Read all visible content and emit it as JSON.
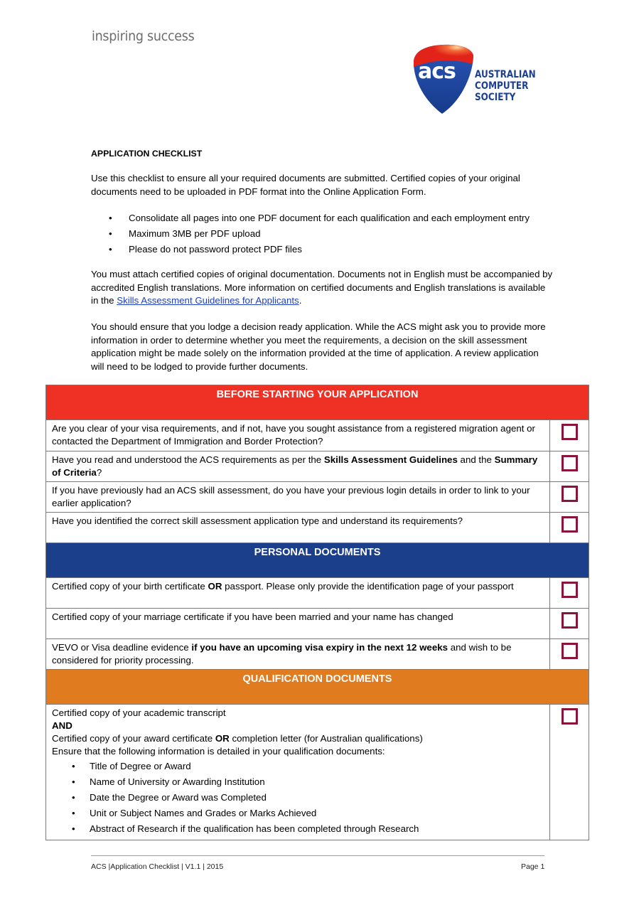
{
  "header": {
    "tagline": "inspiring success",
    "logo": {
      "mark": "acs",
      "name_lines": [
        "AUSTRALIAN",
        "COMPUTER",
        "SOCIETY"
      ],
      "colors": {
        "shield_blue": "#1c3f94",
        "shield_red": "#e2231a",
        "text_blue": "#1c3f94"
      }
    }
  },
  "document": {
    "title": "APPLICATION CHECKLIST",
    "intro": "Use this checklist to ensure all your required documents are submitted. Certified copies of your original documents need to be uploaded in PDF format into the Online Application Form.",
    "bullets": [
      "Consolidate all pages into one PDF document for each qualification and each employment entry",
      "Maximum 3MB per PDF upload",
      "Please do not password protect PDF files"
    ],
    "para2_before_link": "You must attach certified copies of original documentation. Documents not in English must be accompanied by accredited English translations. More information on certified documents and English translations is available in the ",
    "para2_link": "Skills Assessment Guidelines for Applicants",
    "para2_after_link": ".",
    "para3": "You should ensure that you lodge a decision ready application. While the ACS might ask you to provide more information in order to determine whether you meet the requirements, a decision on the skill assessment application might be made solely on the information provided at the time of application. A review application will need to be lodged to provide further documents."
  },
  "checklist": {
    "sections": [
      {
        "title": "BEFORE STARTING YOUR APPLICATION",
        "color": "#ee3124",
        "items": [
          {
            "parts": [
              {
                "t": "Are you clear of your visa requirements, and if not, have you sought assistance from a registered migration agent or contacted the Department of Immigration and Border Protection?"
              }
            ],
            "checked": false
          },
          {
            "parts": [
              {
                "t": "Have you read and understood the ACS requirements as per the "
              },
              {
                "t": "Skills Assessment Guidelines",
                "b": true
              },
              {
                "t": " and the "
              },
              {
                "t": "Summary of Criteria",
                "b": true
              },
              {
                "t": "?"
              }
            ],
            "checked": false
          },
          {
            "parts": [
              {
                "t": "If you have previously had an ACS skill assessment, do you have your previous login details in order to link to your earlier application?"
              }
            ],
            "checked": false
          },
          {
            "parts": [
              {
                "t": "Have you identified the correct skill assessment application type and understand its requirements?"
              }
            ],
            "checked": false
          }
        ]
      },
      {
        "title": "PERSONAL DOCUMENTS",
        "color": "#1b3f8b",
        "items": [
          {
            "parts": [
              {
                "t": "Certified copy of your birth certificate "
              },
              {
                "t": "OR",
                "b": true
              },
              {
                "t": " passport. Please only provide the identification page of your passport"
              }
            ],
            "checked": false
          },
          {
            "parts": [
              {
                "t": "Certified copy of your marriage certificate if you have been married and your name has changed"
              }
            ],
            "checked": false
          },
          {
            "parts": [
              {
                "t": "VEVO or Visa deadline evidence "
              },
              {
                "t": "if you have an upcoming visa expiry in the next 12 weeks",
                "b": true
              },
              {
                "t": " and wish to be considered for priority processing."
              }
            ],
            "checked": false
          }
        ]
      },
      {
        "title": "QUALIFICATION DOCUMENTS",
        "color": "#e07b1f",
        "items": [
          {
            "lines": [
              [
                {
                  "t": "Certified copy of your academic transcript"
                }
              ],
              [
                {
                  "t": "AND",
                  "b": true
                }
              ],
              [
                {
                  "t": "Certified copy of your award certificate "
                },
                {
                  "t": "OR",
                  "b": true
                },
                {
                  "t": " completion letter (for Australian qualifications)"
                }
              ],
              [
                {
                  "t": "Ensure that the following information is detailed in your qualification documents:"
                }
              ]
            ],
            "sub_bullets": [
              "Title of Degree or Award",
              "Name of University or Awarding Institution",
              "Date the Degree or Award was Completed",
              "Unit or Subject Names and Grades or Marks Achieved",
              "Abstract of Research if the qualification has been completed through Research"
            ],
            "checked": false
          }
        ]
      }
    ],
    "checkbox_color": "#8a1538"
  },
  "footer": {
    "left": "ACS |Application Checklist | V1.1 | 2015",
    "right": "Page 1"
  }
}
